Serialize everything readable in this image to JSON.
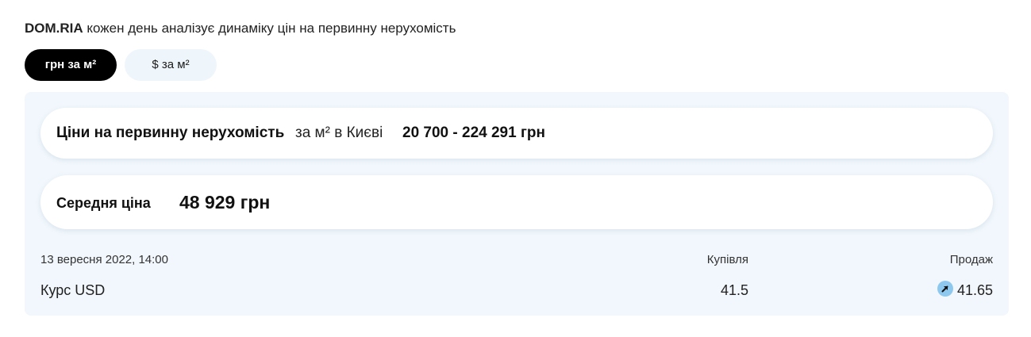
{
  "intro": {
    "brand": "DOM.RIA",
    "text": " кожен день аналізує динаміку цін на первинну нерухомість"
  },
  "unit_toggle": {
    "options": [
      {
        "label": "грн за м²",
        "active": true
      },
      {
        "label": "$ за м²",
        "active": false
      }
    ]
  },
  "price_range": {
    "title": "Ціни на первинну нерухомість",
    "subtitle": "за м² в Києві",
    "value": "20 700 - 224 291 грн"
  },
  "average": {
    "title": "Середня ціна",
    "value": "48 929 грн"
  },
  "exchange": {
    "date": "13 вересня 2022, 14:00",
    "buy_label": "Купівля",
    "sell_label": "Продаж",
    "currency": "Курс USD",
    "buy_value": "41.5",
    "sell_value": "41.65",
    "trend_icon": "arrow-up-right-icon",
    "trend_color": "#8fc8ee"
  }
}
